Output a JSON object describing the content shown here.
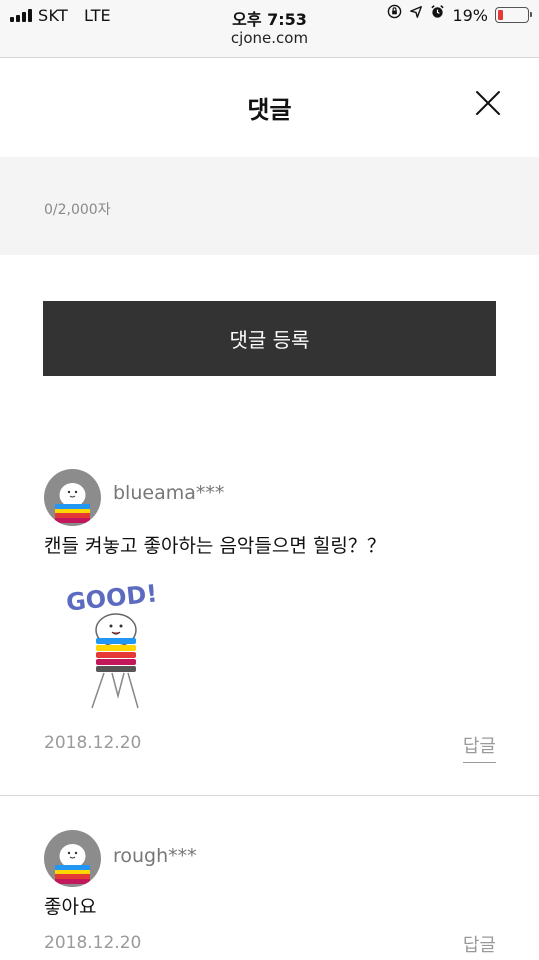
{
  "status_bar": {
    "carrier": "SKT",
    "network": "LTE",
    "time": "오후 7:53",
    "battery_percent": "19%",
    "battery_level": 0.19,
    "battery_color": "#e53935",
    "icons": [
      "signal-icon",
      "lock-rotation-icon",
      "location-arrow-icon",
      "alarm-clock-icon",
      "battery-icon"
    ]
  },
  "browser": {
    "url": "cjone.com"
  },
  "header": {
    "title": "댓글",
    "close_icon": "close-icon"
  },
  "comment_input": {
    "char_count": "0/2,000자"
  },
  "submit": {
    "label": "댓글 등록"
  },
  "comments": [
    {
      "username": "blueama***",
      "text": "캔들 켜놓고 좋아하는 음악들으면 힐링？？",
      "sticker_text": "GOOD!",
      "date": "2018.12.20",
      "reply_label": "답글"
    },
    {
      "username": "rough***",
      "text": "좋아요",
      "date": "2018.12.20",
      "reply_label": "답글"
    }
  ],
  "colors": {
    "button_bg": "#333333",
    "input_bg": "#f4f4f4",
    "sticker_stripes": [
      "#2196f3",
      "#ffd600",
      "#e53935",
      "#c2185b",
      "#555555"
    ]
  }
}
